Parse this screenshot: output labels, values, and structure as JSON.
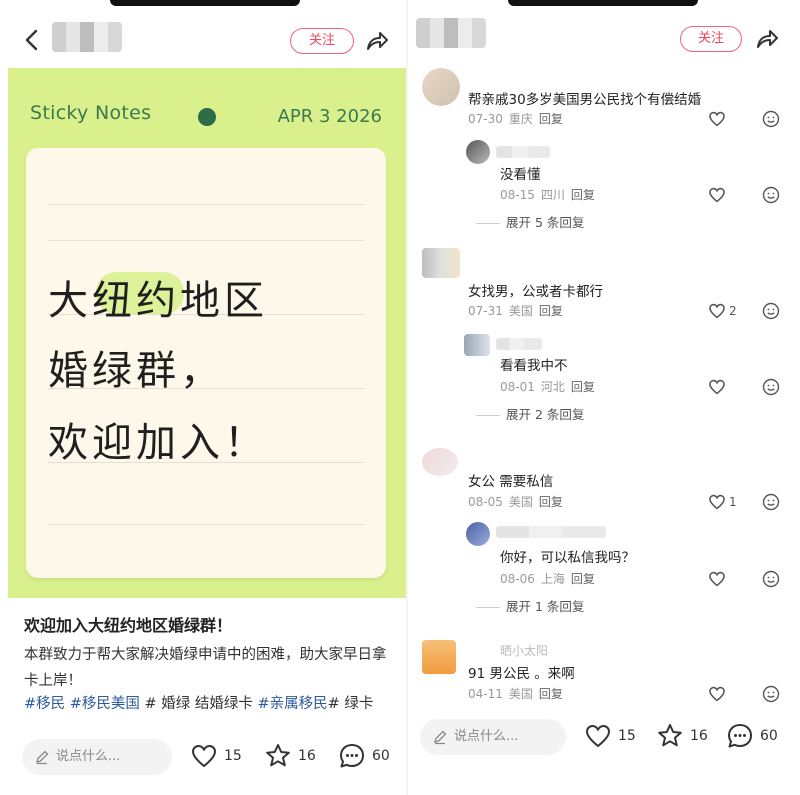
{
  "left": {
    "follow_label": "关注",
    "image": {
      "header": "Sticky Notes",
      "date": "APR 3 2026",
      "lines": [
        "大纽约地区",
        "婚绿群，",
        "欢迎加入！"
      ]
    },
    "post": {
      "title": "欢迎加入大纽约地区婚绿群！",
      "body": "本群致力于帮大家解决婚绿申请中的困难，助大家早日拿卡上岸！",
      "tags": [
        {
          "text": "#移民",
          "type": "tag"
        },
        {
          "text": "#移民美国",
          "type": "tag"
        },
        {
          "text": "# 婚绿 结婚绿卡",
          "type": "plain"
        },
        {
          "text": "#亲属移民",
          "type": "tag"
        },
        {
          "text": "# 绿卡",
          "type": "plain"
        }
      ]
    },
    "bottom": {
      "say_placeholder": "说点什么...",
      "likes": "15",
      "stars": "16",
      "comments": "60"
    }
  },
  "right": {
    "follow_label": "关注",
    "comments": [
      {
        "text": "帮亲戚30多岁美国男公民找个有偿结婚",
        "date": "07-30",
        "place": "重庆",
        "reply": "回复",
        "likes": ""
      },
      {
        "text": "没看懂",
        "date": "08-15",
        "place": "四川",
        "reply": "回复",
        "likes": "",
        "sub": true,
        "expand": "展开 5 条回复"
      },
      {
        "text": "女找男，公或者卡都行",
        "date": "07-31",
        "place": "美国",
        "reply": "回复",
        "likes": "2"
      },
      {
        "text": "看看我中不",
        "date": "08-01",
        "place": "河北",
        "reply": "回复",
        "likes": "",
        "sub": true,
        "expand": "展开 2 条回复"
      },
      {
        "text": "女公 需要私信",
        "date": "08-05",
        "place": "美国",
        "reply": "回复",
        "likes": "1"
      },
      {
        "text": "你好，可以私信我吗？",
        "date": "08-06",
        "place": "上海",
        "reply": "回复",
        "likes": "",
        "sub": true,
        "expand": "展开 1 条回复"
      },
      {
        "text": "91 男公民 。来啊",
        "date": "04-11",
        "place": "美国",
        "reply": "回复",
        "likes": "",
        "name": "晒小太阳"
      }
    ],
    "bottom": {
      "say_placeholder": "说点什么...",
      "likes": "15",
      "stars": "16",
      "comments": "60"
    }
  },
  "colors": {
    "accent": "#f0465f",
    "tag": "#2d5aa0",
    "note_bg": "#d9f08c",
    "paper": "#fdf8ea"
  },
  "icons": {
    "back": "chevron-left-icon",
    "share": "share-arrow-icon",
    "like": "heart-icon",
    "star": "star-icon",
    "comment": "speech-bubble-icon",
    "emoji": "smiley-icon",
    "pen": "pencil-icon"
  }
}
